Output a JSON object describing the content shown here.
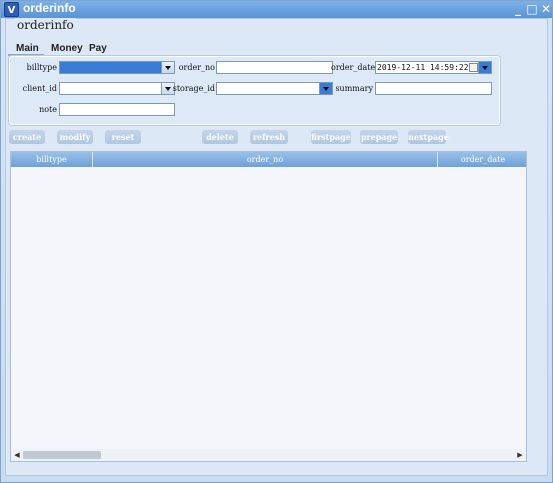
{
  "window": {
    "title": "orderinfo",
    "icon": "app-logo-icon",
    "controls": [
      "_",
      "□",
      "✕"
    ]
  },
  "group_title": "orderinfo",
  "tabs": [
    "Main",
    "Money",
    "Pay"
  ],
  "form": {
    "billtype_label": "billtype",
    "billtype_value": "",
    "order_no_label": "order_no",
    "order_no_value": "",
    "order_date_label": "order_date",
    "order_date_value": "2019-12-11 14:59:22",
    "client_id_label": "client_id",
    "client_id_value": "",
    "storage_id_label": "storage_id",
    "storage_id_value": "",
    "summary_label": "summary",
    "summary_value": "",
    "note_label": "note",
    "note_value": ""
  },
  "buttons": {
    "create": "create",
    "modify": "modify",
    "reset": "reset",
    "delete": "delete",
    "refresh": "refresh",
    "firstpage": "firstpage",
    "prepage": "prepage",
    "nextpage": "nextpage"
  },
  "grid": {
    "columns": [
      "billtype",
      "order_no",
      "order_date"
    ],
    "rows": []
  },
  "colors": {
    "accent": "#3a7bd5",
    "header": "#6ea1d8",
    "titlebar": "#5a93d6"
  }
}
